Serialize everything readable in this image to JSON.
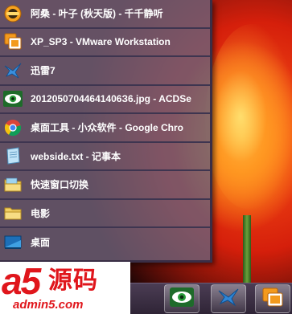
{
  "menu": {
    "items": [
      {
        "label": "阿桑 - 叶子 (秋天版) - 千千静听",
        "icon": "ttplayer-icon"
      },
      {
        "label": "XP_SP3 - VMware Workstation",
        "icon": "vmware-icon"
      },
      {
        "label": "迅雷7",
        "icon": "thunder-icon"
      },
      {
        "label": "20120507044641406З6.jpg - ACDSe",
        "icon": "acdsee-icon"
      },
      {
        "label": "桌面工具 - 小众软件 - Google Chro",
        "icon": "chrome-icon"
      },
      {
        "label": "webside.txt - 记事本",
        "icon": "notepad-icon"
      },
      {
        "label": "快速窗口切换",
        "icon": "folder-icon"
      },
      {
        "label": "电影",
        "icon": "folder-icon"
      },
      {
        "label": "桌面",
        "icon": "desktop-icon"
      }
    ]
  },
  "watermark": {
    "brand": "a5",
    "brand_cn": "源码",
    "url": "admin5.com"
  },
  "taskbar": {
    "buttons": [
      "acdsee-icon",
      "thunder-icon",
      "vmware-icon"
    ]
  },
  "colors": {
    "menu_bg": "#6c6078",
    "menu_border": "#3a2e46",
    "watermark_red": "#e0161c"
  }
}
